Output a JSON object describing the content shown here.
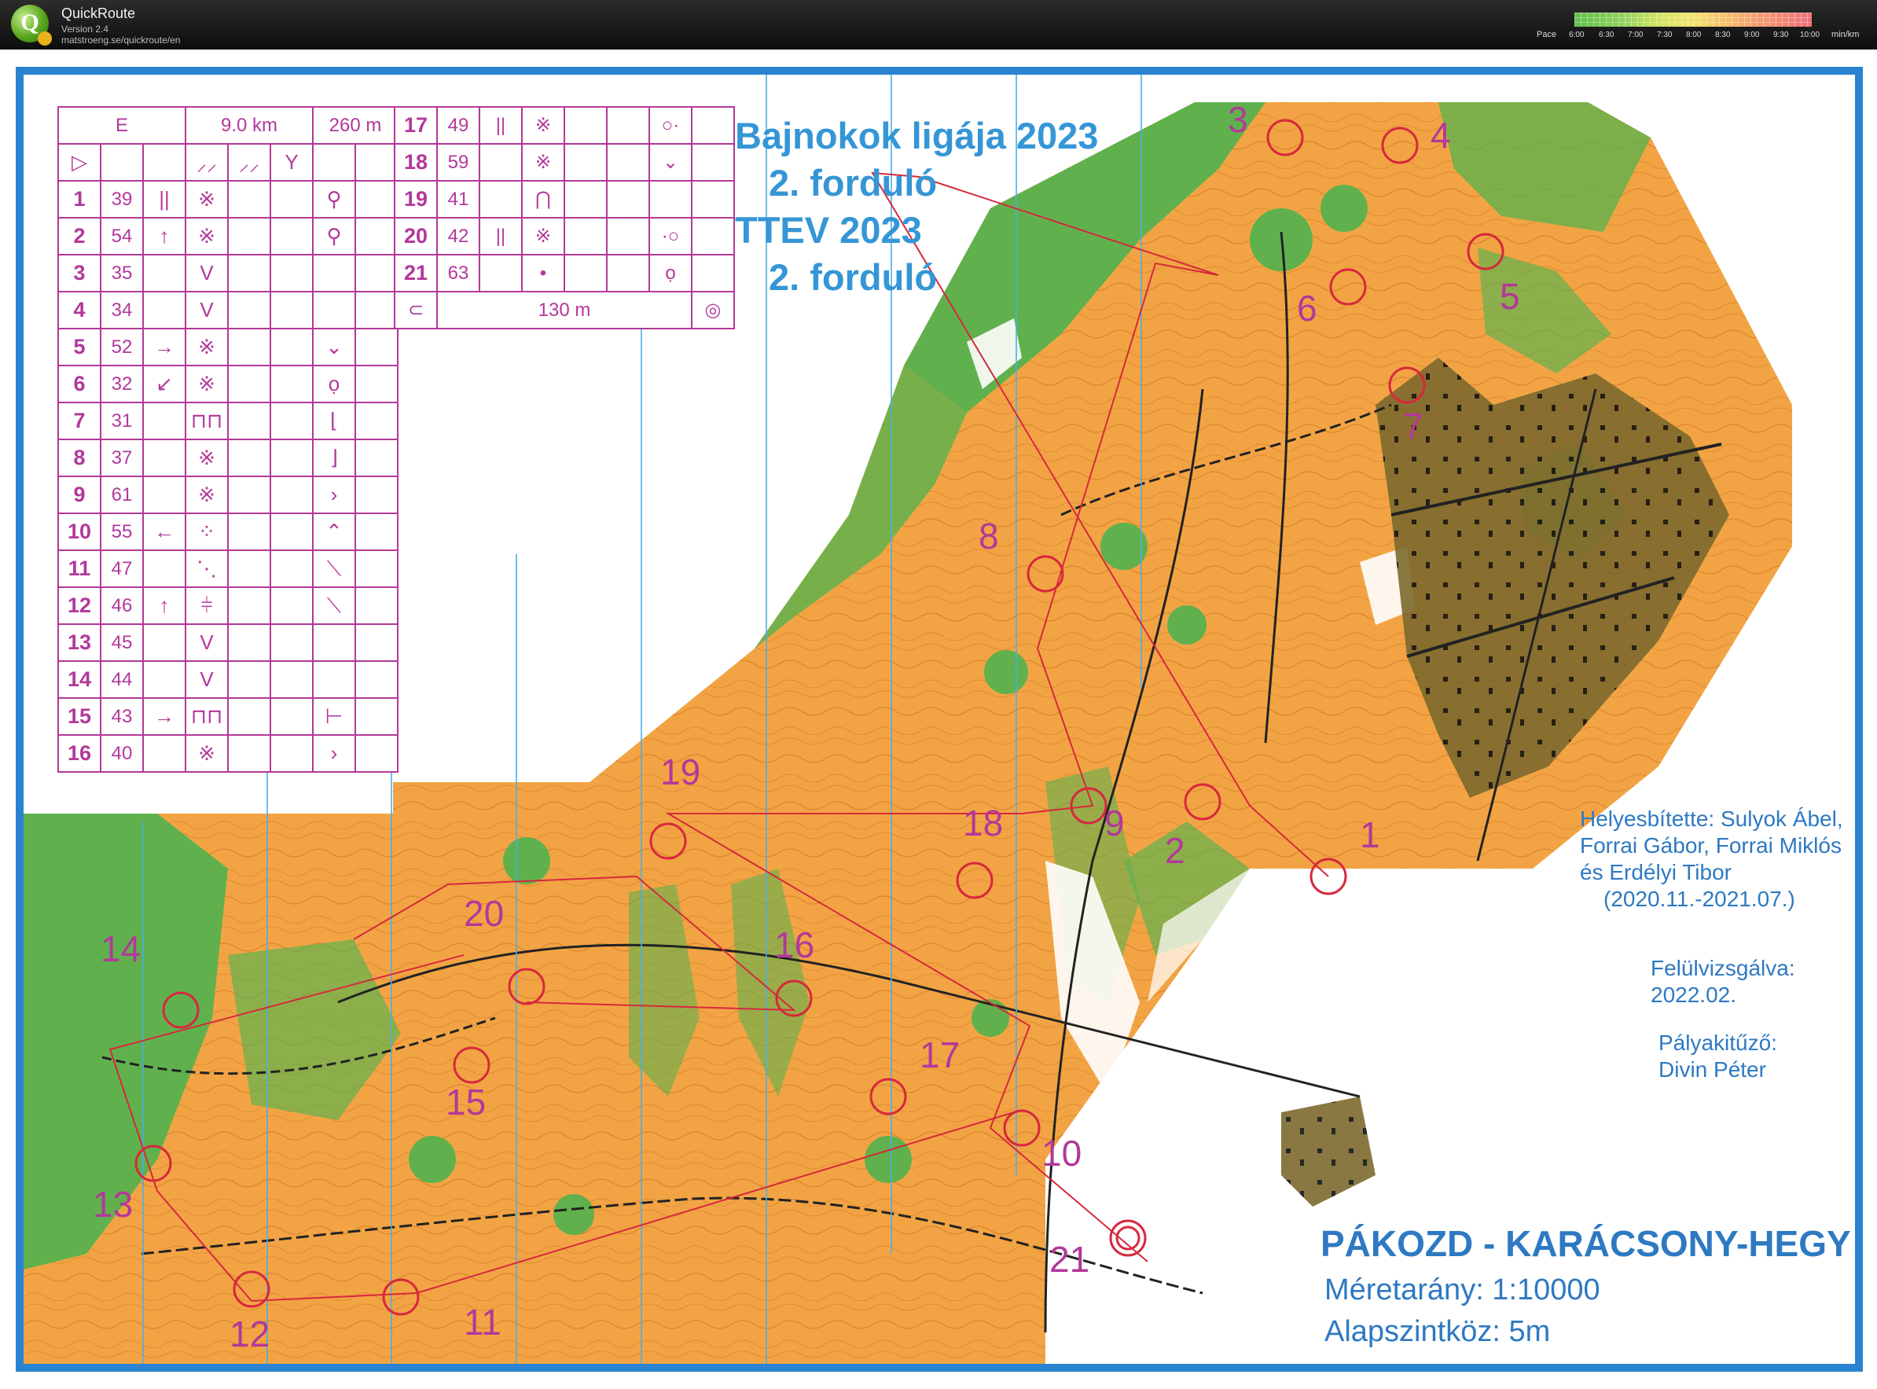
{
  "app": {
    "title": "QuickRoute",
    "version": "Version 2.4",
    "url": "matstroeng.se/quickroute/en",
    "logo_letter": "Q"
  },
  "pace_scale": {
    "label": "Pace",
    "ticks": [
      "6:00",
      "6:30",
      "7:00",
      "7:30",
      "8:00",
      "8:30",
      "9:00",
      "9:30",
      "10:00"
    ],
    "unit": "min/km"
  },
  "course": {
    "class": "E",
    "length": "9.0 km",
    "climb": "260 m",
    "controls": [
      {
        "n": "1",
        "code": "39",
        "c": "||",
        "d": "※",
        "h": "⚲"
      },
      {
        "n": "2",
        "code": "54",
        "c": "↑",
        "d": "※",
        "h": "⚲"
      },
      {
        "n": "3",
        "code": "35",
        "c": "",
        "d": "V",
        "h": ""
      },
      {
        "n": "4",
        "code": "34",
        "c": "",
        "d": "V",
        "h": ""
      },
      {
        "n": "5",
        "code": "52",
        "c": "→",
        "d": "※",
        "h": "⌄"
      },
      {
        "n": "6",
        "code": "32",
        "c": "↙",
        "d": "※",
        "h": "ọ"
      },
      {
        "n": "7",
        "code": "31",
        "c": "",
        "d": "⊓⊓",
        "h": "⌊"
      },
      {
        "n": "8",
        "code": "37",
        "c": "",
        "d": "※",
        "h": "⌋"
      },
      {
        "n": "9",
        "code": "61",
        "c": "",
        "d": "※",
        "h": "›"
      },
      {
        "n": "10",
        "code": "55",
        "c": "←",
        "d": "⁘",
        "h": "⌃"
      },
      {
        "n": "11",
        "code": "47",
        "c": "",
        "d": "⋱",
        "h": "⟍"
      },
      {
        "n": "12",
        "code": "46",
        "c": "↑",
        "d": "⫩",
        "h": "⟍"
      },
      {
        "n": "13",
        "code": "45",
        "c": "",
        "d": "V",
        "h": ""
      },
      {
        "n": "14",
        "code": "44",
        "c": "",
        "d": "V",
        "h": ""
      },
      {
        "n": "15",
        "code": "43",
        "c": "→",
        "d": "⊓⊓",
        "h": "⊢"
      },
      {
        "n": "16",
        "code": "40",
        "c": "",
        "d": "※",
        "h": "›"
      },
      {
        "n": "17",
        "code": "49",
        "c": "||",
        "d": "※",
        "h": "○·"
      },
      {
        "n": "18",
        "code": "59",
        "c": "",
        "d": "※",
        "h": "⌄"
      },
      {
        "n": "19",
        "code": "41",
        "c": "",
        "d": "⋂",
        "h": ""
      },
      {
        "n": "20",
        "code": "42",
        "c": "||",
        "d": "※",
        "h": "·○"
      },
      {
        "n": "21",
        "code": "63",
        "c": "",
        "d": "•",
        "h": "ọ"
      }
    ],
    "finish_distance": "130 m"
  },
  "titles": {
    "line1": "Bajnokok ligája 2023",
    "line2": "2. forduló",
    "line3": "TTEV 2023",
    "line4": "2. forduló"
  },
  "credits": {
    "l1": "Helyesbítette: Sulyok Ábel,",
    "l2": "Forrai Gábor, Forrai Miklós",
    "l3": "és Erdélyi Tibor",
    "l4": "(2020.11.-2021.07.)",
    "rev1": "Felülvizsgálva:",
    "rev2": "2022.02.",
    "setter1": "Pályakitűző:",
    "setter2": "Divin Péter"
  },
  "map_name": "PÁKOZD - KARÁCSONY-HEGY",
  "scale_text": "Méretarány: 1:10000",
  "contour_text": "Alapszintköz: 5m",
  "control_labels": [
    "1",
    "2",
    "3",
    "4",
    "5",
    "6",
    "7",
    "8",
    "9",
    "10",
    "11",
    "12",
    "13",
    "14",
    "15",
    "16",
    "17",
    "18",
    "19",
    "20",
    "21"
  ],
  "colors": {
    "frame": "#2a83d2",
    "purple": "#b3389a",
    "orange": "#f2a444",
    "green": "#4fb04a",
    "text_blue": "#2e79c2"
  }
}
